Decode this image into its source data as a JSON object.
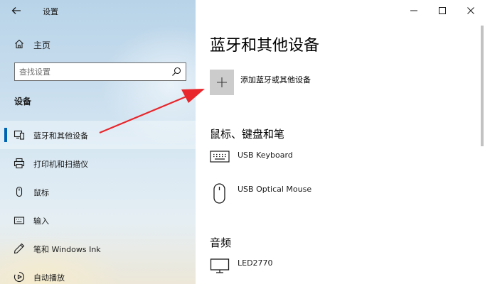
{
  "window": {
    "app_title": "设置"
  },
  "nav": {
    "home_label": "主页",
    "search_placeholder": "查找设置",
    "section_heading": "设备",
    "items": [
      {
        "label": "蓝牙和其他设备",
        "icon": "bluetooth-devices-icon",
        "selected": true
      },
      {
        "label": "打印机和扫描仪",
        "icon": "printer-icon",
        "selected": false
      },
      {
        "label": "鼠标",
        "icon": "mouse-icon",
        "selected": false
      },
      {
        "label": "输入",
        "icon": "keyboard-icon",
        "selected": false
      },
      {
        "label": "笔和 Windows Ink",
        "icon": "pen-icon",
        "selected": false
      },
      {
        "label": "自动播放",
        "icon": "autoplay-icon",
        "selected": false
      }
    ]
  },
  "content": {
    "page_title": "蓝牙和其他设备",
    "add_device_label": "添加蓝牙或其他设备",
    "mouse_keyboard_pen": {
      "title": "鼠标、键盘和笔",
      "devices": [
        {
          "name": "USB Keyboard",
          "icon": "keyboard-icon"
        },
        {
          "name": "USB Optical Mouse",
          "icon": "mouse-icon"
        }
      ]
    },
    "audio": {
      "title": "音频",
      "devices": [
        {
          "name": "LED2770",
          "icon": "monitor-icon"
        }
      ]
    }
  },
  "colors": {
    "accent": "#0063b1",
    "annotation_arrow": "#e8262b",
    "add_button_bg": "#cccccc"
  }
}
